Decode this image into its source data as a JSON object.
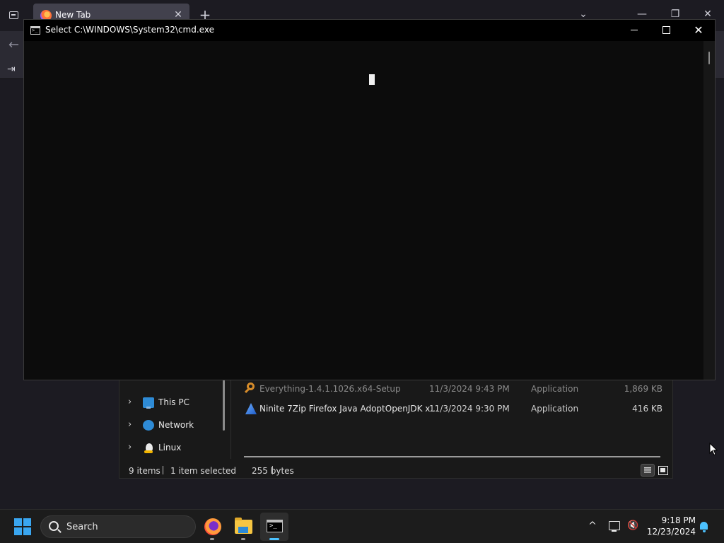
{
  "browser": {
    "tab": {
      "title": "New Tab"
    },
    "controls": {
      "tab_close": "✕",
      "new_tab": "+",
      "tab_list": "⌄",
      "minimize": "—",
      "restore": "❐",
      "close": "✕"
    },
    "nav": {
      "back": "←"
    },
    "bookmarks": {
      "import_icon": "⇥"
    }
  },
  "cmd": {
    "title": "Select C:\\WINDOWS\\System32\\cmd.exe",
    "controls": {
      "minimize": "",
      "maximize": "",
      "close": "✕"
    }
  },
  "explorer": {
    "nav_items": [
      {
        "label": "This PC",
        "icon": "this-pc-icon"
      },
      {
        "label": "Network",
        "icon": "network-icon"
      },
      {
        "label": "Linux",
        "icon": "linux-icon"
      }
    ],
    "files": [
      {
        "name": "Everything-1.4.1.1026.x64-Setup",
        "date": "11/3/2024 9:43 PM",
        "type": "Application",
        "size": "1,869 KB"
      },
      {
        "name": "Ninite 7Zip Firefox Java AdoptOpenJDK x...",
        "date": "11/3/2024 9:30 PM",
        "type": "Application",
        "size": "416 KB"
      }
    ],
    "status": {
      "items": "9 items",
      "selected": "1 item selected",
      "size": "255 bytes"
    }
  },
  "taskbar": {
    "search_label": "Search",
    "apps": [
      "firefox",
      "file-explorer",
      "command-prompt"
    ],
    "tray": {
      "chevron": "^",
      "time": "9:18 PM",
      "date": "12/23/2024"
    }
  },
  "colors": {
    "accent": "#4cc2ff",
    "start": "#3aa6f0",
    "cmd_bg": "#0c0c0c"
  }
}
